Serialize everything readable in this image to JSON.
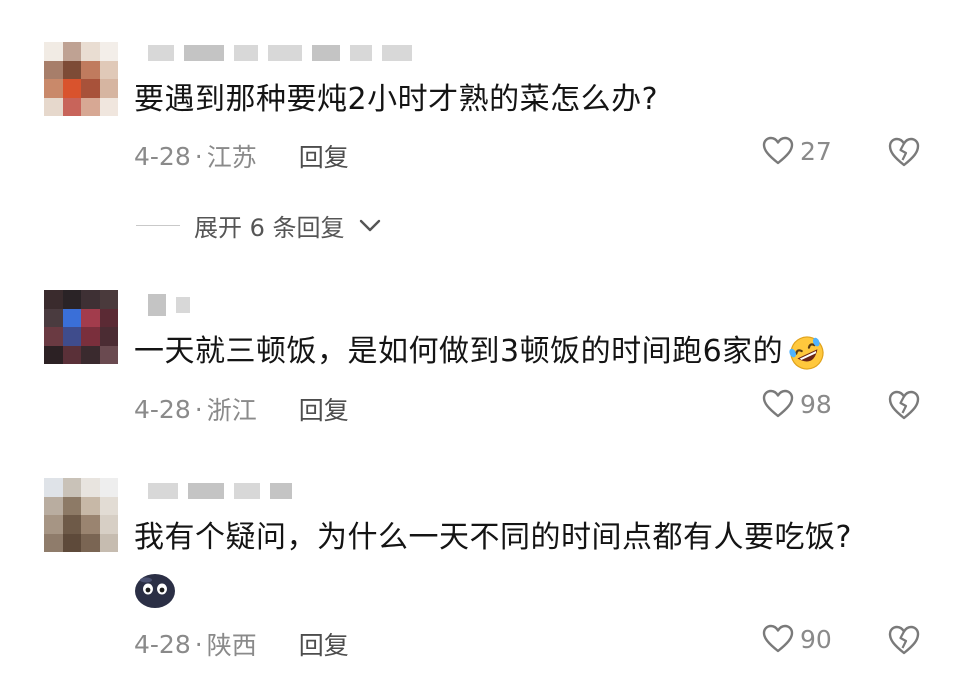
{
  "comments": [
    {
      "text": "要遇到那种要炖2小时才熟的菜怎么办?",
      "date": "4-28",
      "location": "江苏",
      "reply_label": "回复",
      "likes": "27"
    },
    {
      "text": "一天就三顿饭，是如何做到3顿饭的时间跑6家的",
      "date": "4-28",
      "location": "浙江",
      "reply_label": "回复",
      "likes": "98",
      "emoji": "rofl-emoji"
    },
    {
      "text": "我有个疑问，为什么一天不同的时间点都有人要吃饭?",
      "date": "4-28",
      "location": "陕西",
      "reply_label": "回复",
      "likes": "90",
      "sticker": "dark-blob-emoji"
    }
  ],
  "expand_replies": {
    "label": "展开 6 条回复"
  },
  "colors": {
    "text": "#141414",
    "meta": "#8a8a8a",
    "reply": "#4d4d4d",
    "icon_outline": "#7a7a7a",
    "background": "#ffffff"
  }
}
